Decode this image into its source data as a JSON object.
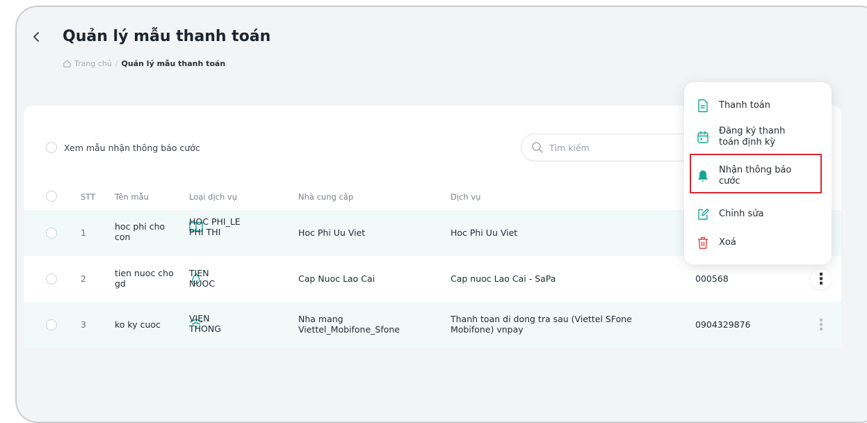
{
  "page": {
    "back_icon": "chevron-left-icon",
    "title": "Quản lý mẫu thanh toán",
    "breadcrumb": {
      "home": "Trang chủ",
      "separator": "/",
      "current": "Quản lý mẫu thanh toán"
    }
  },
  "toolbar": {
    "toggle_label": "Xem mẫu nhận thông báo cước",
    "search_placeholder": "Tìm kiếm"
  },
  "table": {
    "headers": {
      "stt": "STT",
      "name": "Tên mẫu",
      "type": "Loại dịch vụ",
      "provider": "Nhà cung cấp",
      "service": "Dịch vụ"
    },
    "rows": [
      {
        "stt": "1",
        "name": "hoc phi cho con",
        "type": "HOC PHI_LE PHI THI",
        "type_icon": "book-icon",
        "provider": "Hoc Phi Uu Viet",
        "service": "Hoc Phi Uu Viet",
        "code": ""
      },
      {
        "stt": "2",
        "name": "tien nuoc cho gd",
        "type": "TIEN NUOC",
        "type_icon": "water-drop-icon",
        "provider": "Cap Nuoc Lao Cai",
        "service": "Cap nuoc Lao Cai - SaPa",
        "code": "000568"
      },
      {
        "stt": "3",
        "name": "ko ky cuoc",
        "type": "VIEN THONG",
        "type_icon": "wifi-icon",
        "provider": "Nha mang Viettel_Mobifone_Sfone",
        "service": "Thanh toan di dong tra sau (Viettel SFone Mobifone) vnpay",
        "code": "0904329876"
      }
    ]
  },
  "context_menu": {
    "items": [
      {
        "label": "Thanh toán",
        "icon": "document-icon",
        "color": "#16a59a"
      },
      {
        "label": "Đăng ký thanh toán định kỳ",
        "icon": "calendar-icon",
        "color": "#16a59a"
      },
      {
        "label": "Nhận thông báo cước",
        "icon": "bell-icon",
        "color": "#16a59a"
      },
      {
        "label": "Chỉnh sửa",
        "icon": "edit-icon",
        "color": "#16a59a"
      },
      {
        "label": "Xoá",
        "icon": "trash-icon",
        "color": "#e0433e"
      }
    ]
  },
  "colors": {
    "accent": "#16a59a",
    "danger": "#e0433e",
    "highlight_border": "#d9252e",
    "row_alt": "#f2f9f9"
  }
}
